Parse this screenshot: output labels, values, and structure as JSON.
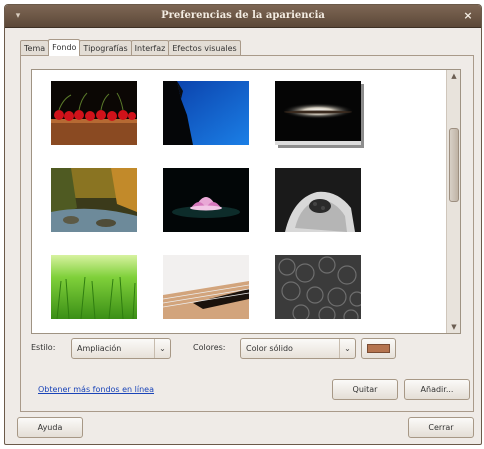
{
  "window": {
    "title": "Preferencias de la apariencia"
  },
  "tabs": [
    {
      "label": "Tema"
    },
    {
      "label": "Fondo",
      "active": true
    },
    {
      "label": "Tipografías"
    },
    {
      "label": "Interfaz"
    },
    {
      "label": "Efectos visuales"
    }
  ],
  "gallery": {
    "items": [
      {
        "name": "cherries"
      },
      {
        "name": "blue-sky-silhouette"
      },
      {
        "name": "sombrero-galaxy",
        "selected": true
      },
      {
        "name": "forest-stream"
      },
      {
        "name": "lotus-flower"
      },
      {
        "name": "hands-with-seeds"
      },
      {
        "name": "green-grass"
      },
      {
        "name": "guitar-strings"
      },
      {
        "name": "gray-texture"
      }
    ]
  },
  "style": {
    "label": "Estilo:",
    "value": "Ampliación"
  },
  "colors": {
    "label": "Colores:",
    "value": "Color sólido",
    "swatch": "#b5744f"
  },
  "link": {
    "text": "Obtener más fondos en línea"
  },
  "buttons": {
    "remove": "Quitar",
    "add": "Añadir...",
    "help": "Ayuda",
    "close": "Cerrar"
  }
}
